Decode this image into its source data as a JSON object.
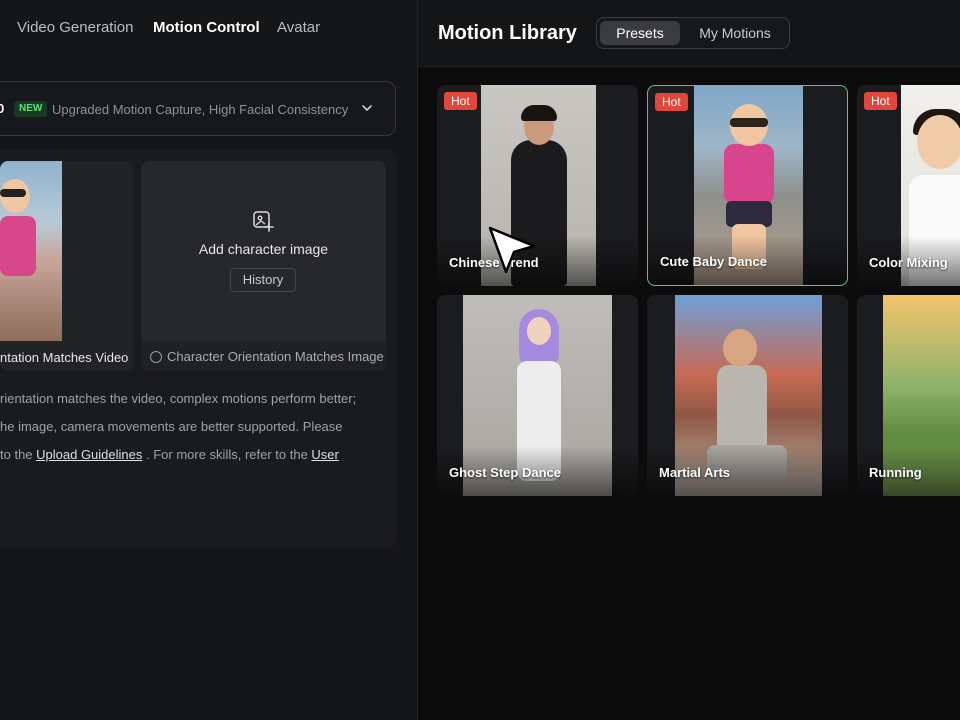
{
  "nav": {
    "tabs": [
      {
        "label": "Video Generation"
      },
      {
        "label": "Motion Control"
      },
      {
        "label": "Avatar"
      }
    ]
  },
  "version_bar": {
    "version_fragment": "0",
    "badge": "NEW",
    "description": "Upgraded Motion Capture, High Facial Consistency"
  },
  "character": {
    "orientation_video_label": "ntation Matches Video",
    "add_image_label": "Add character image",
    "history_button": "History",
    "orientation_image_label": "Character Orientation Matches Image"
  },
  "info": {
    "line1": "rientation matches the video, complex motions perform better;",
    "line2": "he image, camera movements are better supported. Please",
    "line3_prefix": "to the ",
    "upload_link": "Upload Guidelines",
    "line3_middle": " . For more skills, refer to the ",
    "user_link": "User"
  },
  "library": {
    "title": "Motion Library",
    "segments": [
      "Presets",
      "My Motions"
    ],
    "presets": [
      {
        "name": "Chinese Trend",
        "badge": "Hot",
        "selected": false
      },
      {
        "name": "Cute Baby Dance",
        "badge": "Hot",
        "selected": true
      },
      {
        "name": "Color Mixing",
        "badge": "Hot",
        "selected": false
      },
      {
        "name": "Ghost Step Dance",
        "badge": "",
        "selected": false
      },
      {
        "name": "Martial Arts",
        "badge": "",
        "selected": false
      },
      {
        "name": "Running",
        "badge": "",
        "selected": false
      }
    ]
  },
  "colors": {
    "accent_green": "#4fd16a",
    "hot_red": "#e0473a",
    "new_badge_text": "#5ee07a"
  }
}
